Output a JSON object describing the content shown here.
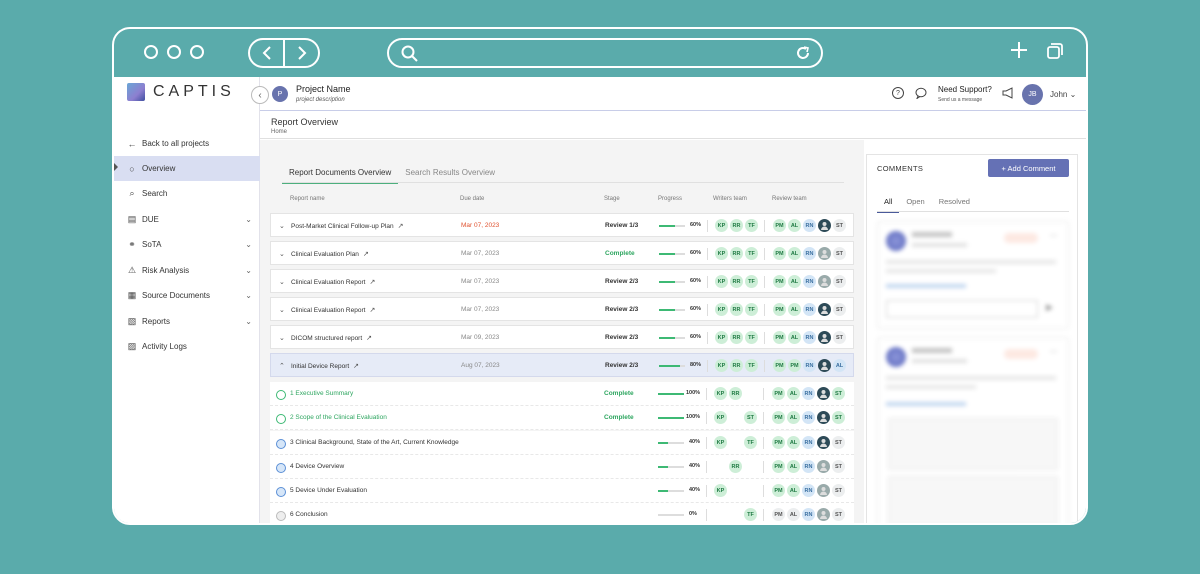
{
  "browser": {
    "back": "‹",
    "forward": "›"
  },
  "logo": {
    "text": "CAPTIS"
  },
  "sidebar": {
    "collapse": "‹",
    "items": [
      {
        "label": "Back to all projects",
        "icon": "←",
        "name": "back-arrow-icon",
        "chev": ""
      },
      {
        "label": "Overview",
        "icon": "○",
        "name": "overview-icon",
        "chev": ""
      },
      {
        "label": "Search",
        "icon": "⌕",
        "name": "search-icon",
        "chev": ""
      },
      {
        "label": "DUE",
        "icon": "▤",
        "name": "book-icon",
        "chev": "⌄"
      },
      {
        "label": "SoTA",
        "icon": "⚭",
        "name": "network-icon",
        "chev": "⌄"
      },
      {
        "label": "Risk Analysis",
        "icon": "⚠",
        "name": "warning-icon",
        "chev": "⌄"
      },
      {
        "label": "Source Documents",
        "icon": "▦",
        "name": "documents-icon",
        "chev": "⌄"
      },
      {
        "label": "Reports",
        "icon": "▧",
        "name": "reports-icon",
        "chev": "⌄"
      },
      {
        "label": "Activity Logs",
        "icon": "▨",
        "name": "logs-icon",
        "chev": ""
      }
    ]
  },
  "topbar": {
    "project_initial": "P",
    "project_name": "Project Name",
    "project_description": "project description",
    "help": "?",
    "chat": "◌",
    "support_title": "Need Support?",
    "support_sub": "Send us a message",
    "announce": "◁",
    "user_initials": "JB",
    "user_name": "John ⌄"
  },
  "page": {
    "title": "Report Overview",
    "breadcrumb": "Home"
  },
  "report_tabs": [
    "Report Documents Overview",
    "Search Results Overview"
  ],
  "table": {
    "headers": [
      "Report name",
      "Due date",
      "Stage",
      "Progress",
      "Writers team",
      "Review team"
    ],
    "rows": [
      {
        "name": "Post-Market Clinical Follow-up Plan",
        "due": "Mar 07, 2023",
        "due_color": "#e0522f",
        "stage": "Review 1/3",
        "stage_color": "#333",
        "progress": 0.6,
        "pct": "60%",
        "writers": [
          "KP",
          "RR",
          "TF"
        ],
        "reviewers": [
          "PM",
          "AL",
          "RN",
          "*",
          "ST"
        ],
        "kind": "doc"
      },
      {
        "name": "Clinical Evaluation Plan",
        "due": "Mar 07, 2023",
        "due_color": "#888",
        "stage": "Complete",
        "stage_color": "#2ea660",
        "progress": 0.6,
        "pct": "60%",
        "writers": [
          "KP",
          "RR",
          "TF"
        ],
        "reviewers": [
          "PM",
          "AL",
          "RN",
          "*g",
          "ST"
        ],
        "kind": "doc"
      },
      {
        "name": "Clinical Evaluation Report",
        "due": "Mar 07, 2023",
        "due_color": "#888",
        "stage": "Review 2/3",
        "stage_color": "#333",
        "progress": 0.6,
        "pct": "60%",
        "writers": [
          "KP",
          "RR",
          "TF"
        ],
        "reviewers": [
          "PM",
          "AL",
          "RN",
          "*g",
          "ST"
        ],
        "kind": "doc"
      },
      {
        "name": "Clinical Evaluation Report",
        "due": "Mar 07, 2023",
        "due_color": "#888",
        "stage": "Review 2/3",
        "stage_color": "#333",
        "progress": 0.6,
        "pct": "60%",
        "writers": [
          "KP",
          "RR",
          "TF"
        ],
        "reviewers": [
          "PM",
          "AL",
          "RN",
          "*",
          "ST"
        ],
        "kind": "doc"
      },
      {
        "name": "DICOM structured report",
        "due": "Mar 09, 2023",
        "due_color": "#888",
        "stage": "Review 2/3",
        "stage_color": "#333",
        "progress": 0.6,
        "pct": "60%",
        "writers": [
          "KP",
          "RR",
          "TF"
        ],
        "reviewers": [
          "PM",
          "AL",
          "RN",
          "*",
          "ST"
        ],
        "kind": "doc"
      },
      {
        "name": "Initial Device Report",
        "due": "Aug 07, 2023",
        "due_color": "#888",
        "stage": "Review 2/3",
        "stage_color": "#333",
        "progress": 0.8,
        "pct": "80%",
        "writers": [
          "KP",
          "RR",
          "TF"
        ],
        "reviewers": [
          "PM",
          "PM",
          "RN",
          "*",
          "AL"
        ],
        "kind": "expanded"
      },
      {
        "name": "1 Executive Summary",
        "due": "",
        "due_color": "#888",
        "stage": "Complete",
        "stage_color": "#2ea660",
        "progress": 1.0,
        "pct": "100%",
        "writers": [
          "KP",
          "RR"
        ],
        "reviewers": [
          "PM",
          "AL",
          "RN",
          "*",
          "ST"
        ],
        "kind": "done"
      },
      {
        "name": "2 Scope of the Clinical Evaluation",
        "due": "",
        "due_color": "#888",
        "stage": "Complete",
        "stage_color": "#2ea660",
        "progress": 1.0,
        "pct": "100%",
        "writers": [
          "KP",
          "",
          "ST"
        ],
        "reviewers": [
          "PM",
          "AL",
          "RN",
          "*",
          "ST"
        ],
        "kind": "done"
      },
      {
        "name": "3 Clinical Background, State of the Art, Current Knowledge",
        "due": "",
        "due_color": "#888",
        "stage": "",
        "stage_color": "#333",
        "progress": 0.4,
        "pct": "40%",
        "writers": [
          "KP",
          "",
          "TF"
        ],
        "reviewers": [
          "PM",
          "AL",
          "RN",
          "*",
          "ST"
        ],
        "kind": "progress"
      },
      {
        "name": "4 Device Overview",
        "due": "",
        "due_color": "#888",
        "stage": "",
        "stage_color": "#333",
        "progress": 0.4,
        "pct": "40%",
        "writers": [
          "",
          "RR",
          ""
        ],
        "reviewers": [
          "PM",
          "AL",
          "RN",
          "*g",
          "ST"
        ],
        "kind": "progress"
      },
      {
        "name": "5 Device Under Evaluation",
        "due": "",
        "due_color": "#888",
        "stage": "",
        "stage_color": "#333",
        "progress": 0.4,
        "pct": "40%",
        "writers": [
          "KP",
          "",
          ""
        ],
        "reviewers": [
          "PM",
          "AL",
          "RN",
          "*g",
          "ST"
        ],
        "kind": "progress"
      },
      {
        "name": "6 Conclusion",
        "due": "",
        "due_color": "#888",
        "stage": "",
        "stage_color": "#333",
        "progress": 0.0,
        "pct": "0%",
        "writers": [
          "",
          "",
          "TF"
        ],
        "reviewers": [
          "PM",
          "AL",
          "RN",
          "*g",
          "ST"
        ],
        "kind": "todo"
      }
    ]
  },
  "comments": {
    "title": "COMMENTS",
    "add_label": "+ Add Comment",
    "tabs": [
      "All",
      "Open",
      "Resolved"
    ]
  },
  "colors": {
    "accent": "#6571b5",
    "complete": "#2ea660",
    "overdue": "#e0522f",
    "background": "#5aabab"
  }
}
